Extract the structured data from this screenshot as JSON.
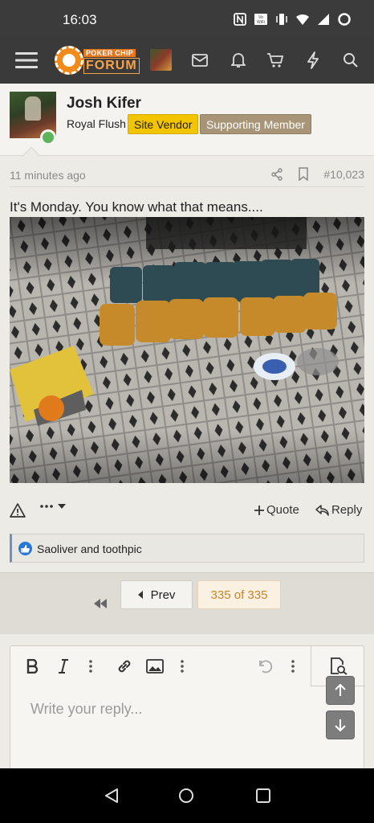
{
  "status_bar": {
    "time": "16:03",
    "icons": [
      "nfc-icon",
      "vowifi-icon",
      "vibrate-icon",
      "wifi-icon",
      "signal-icon",
      "battery-ring-icon"
    ]
  },
  "nav": {
    "logo_line1": "POKER CHIP",
    "logo_line2": "FORUM",
    "icons": [
      "menu-icon",
      "avatar",
      "mail-icon",
      "bell-icon",
      "cart-icon",
      "bolt-icon",
      "search-icon"
    ]
  },
  "post": {
    "author": "Josh Kifer",
    "user_title": "Royal Flush",
    "badges": [
      "Site Vendor",
      "Supporting Member"
    ],
    "time_ago": "11 minutes ago",
    "post_number": "#10,023",
    "text": "It's Monday. You know what that means....",
    "actions": {
      "quote": "Quote",
      "reply": "Reply"
    },
    "reactions": "Saoliver and toothpic"
  },
  "pagination": {
    "prev": "Prev",
    "current": "335 of 335"
  },
  "editor": {
    "placeholder": "Write your reply..."
  },
  "colors": {
    "vendor_badge": "#f3c400",
    "member_badge": "#a89476",
    "accent": "#c8862a",
    "online": "#5bb55b"
  }
}
